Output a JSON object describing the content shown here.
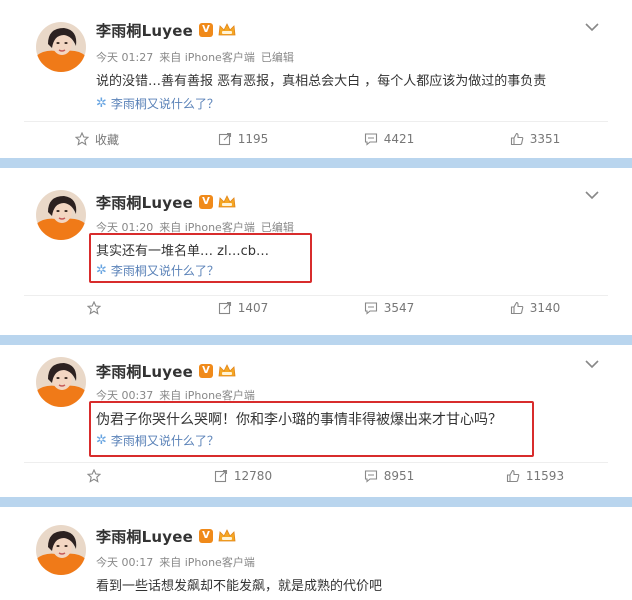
{
  "colors": {
    "separator": "#b9d5ee",
    "link": "#5a82b8",
    "highlight": "#d82c2c",
    "vip": "#f08a1a"
  },
  "posts": [
    {
      "username": "李雨桐Luyee",
      "time": "今天 01:27",
      "source": "来自 iPhone客户端",
      "edited": "已编辑",
      "text": "说的没错…善有善报 恶有恶报，真相总会大白 ，每个人都应该为做过的事负责",
      "topic": "李雨桐又说什么了？",
      "actions": {
        "favorite": "收藏",
        "repost": "1195",
        "comment": "4421",
        "like": "3351"
      }
    },
    {
      "username": "李雨桐Luyee",
      "time": "今天 01:20",
      "source": "来自 iPhone客户端",
      "edited": "已编辑",
      "text": "其实还有一堆名单… zl…cb…",
      "topic": "李雨桐又说什么了？",
      "actions": {
        "favorite": "",
        "repost": "1407",
        "comment": "3547",
        "like": "3140"
      }
    },
    {
      "username": "李雨桐Luyee",
      "time": "今天 00:37",
      "source": "来自 iPhone客户端",
      "edited": "",
      "text": "伪君子你哭什么哭啊！你和李小璐的事情非得被爆出来才甘心吗？",
      "topic": "李雨桐又说什么了？",
      "actions": {
        "favorite": "",
        "repost": "12780",
        "comment": "8951",
        "like": "11593"
      }
    },
    {
      "username": "李雨桐Luyee",
      "time": "今天 00:17",
      "source": "来自 iPhone客户端",
      "edited": "",
      "text": "看到一些话想发飙却不能发飙，就是成熟的代价吧",
      "topic": "",
      "actions": null
    }
  ]
}
